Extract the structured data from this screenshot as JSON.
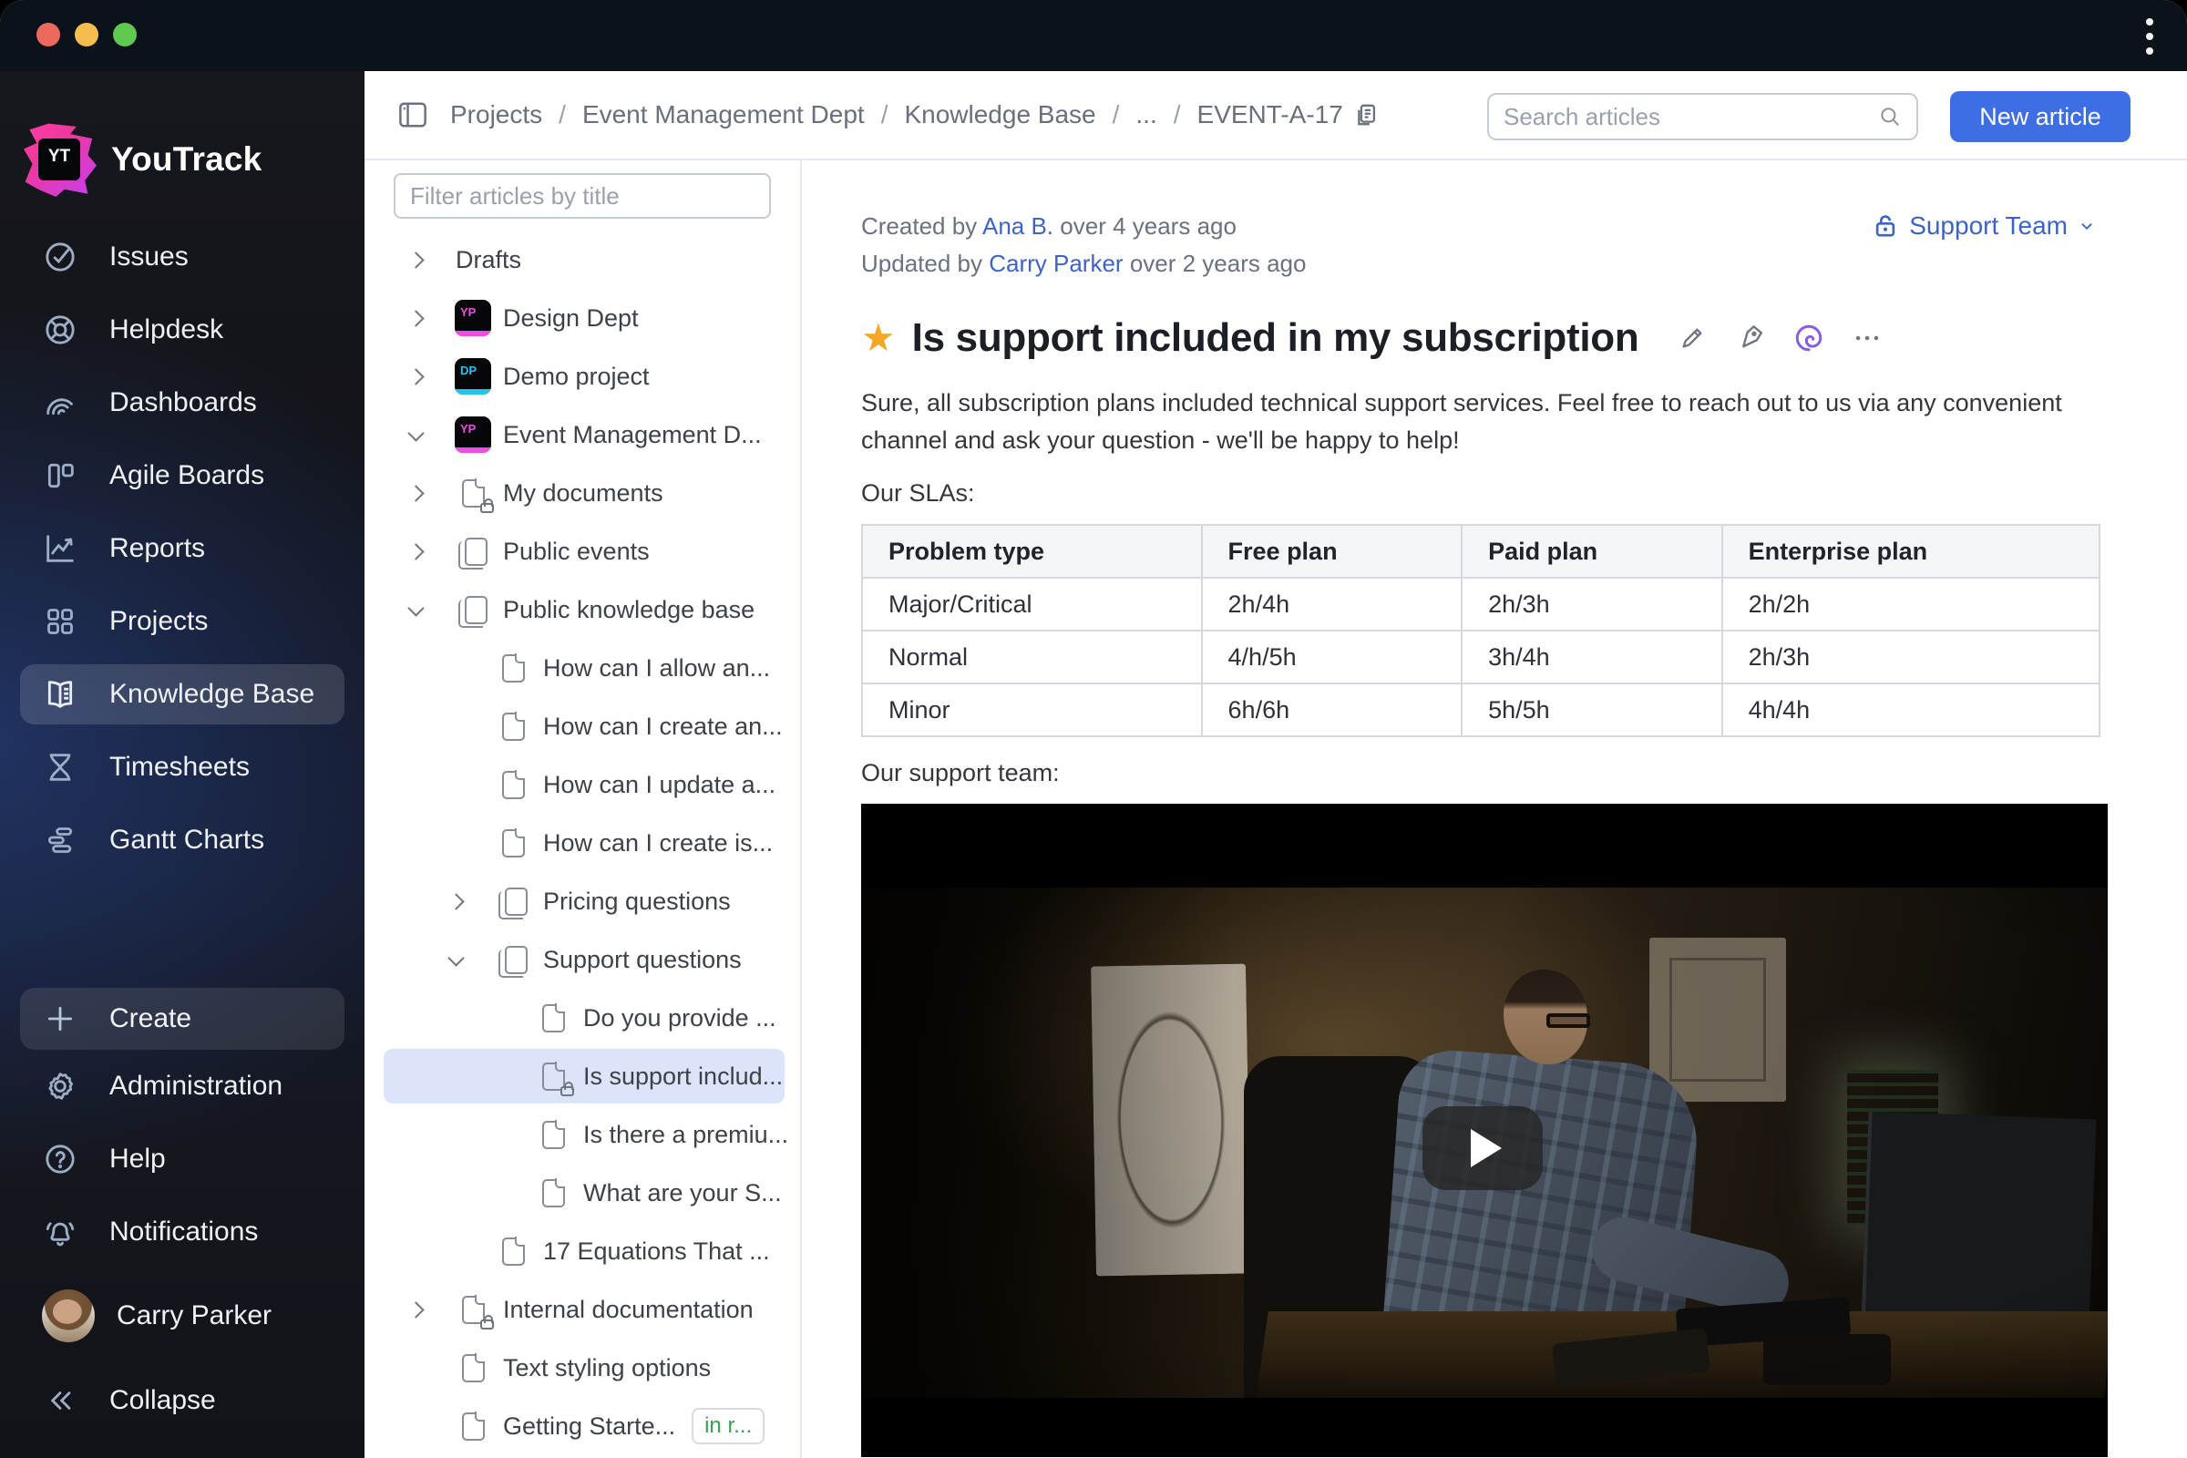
{
  "window": {
    "app_name": "YouTrack"
  },
  "sidebar": {
    "logo_monogram": "YT",
    "logo_text": "YouTrack",
    "items": [
      {
        "label": "Issues"
      },
      {
        "label": "Helpdesk"
      },
      {
        "label": "Dashboards"
      },
      {
        "label": "Agile Boards"
      },
      {
        "label": "Reports"
      },
      {
        "label": "Projects"
      },
      {
        "label": "Knowledge Base",
        "selected": true
      },
      {
        "label": "Timesheets"
      },
      {
        "label": "Gantt Charts"
      }
    ],
    "create_label": "Create",
    "footer_items": [
      {
        "label": "Administration"
      },
      {
        "label": "Help"
      },
      {
        "label": "Notifications"
      }
    ],
    "user_name": "Carry Parker",
    "collapse_label": "Collapse"
  },
  "topbar": {
    "breadcrumb": [
      "Projects",
      "Event Management Dept",
      "Knowledge Base",
      "...",
      "EVENT-A-17"
    ],
    "search_placeholder": "Search articles",
    "new_article_label": "New article"
  },
  "tree": {
    "filter_placeholder": "Filter articles by title",
    "items": [
      {
        "label": "Drafts"
      },
      {
        "label": "Design Dept",
        "project_initials": "YP",
        "project_color": "#ef4fe0"
      },
      {
        "label": "Demo project",
        "project_initials": "DP",
        "project_color": "#22c3f4"
      },
      {
        "label": "Event Management D...",
        "project_initials": "YP",
        "project_color": "#ef4fe0"
      },
      {
        "label": "My documents"
      },
      {
        "label": "Public events"
      },
      {
        "label": "Public knowledge base"
      },
      {
        "label": "How can I allow an..."
      },
      {
        "label": "How can I create an..."
      },
      {
        "label": "How can I update a..."
      },
      {
        "label": "How can I create is..."
      },
      {
        "label": "Pricing questions"
      },
      {
        "label": "Support questions"
      },
      {
        "label": "Do you provide ..."
      },
      {
        "label": "Is support includ...",
        "selected": true
      },
      {
        "label": "Is there a premiu..."
      },
      {
        "label": "What are your S..."
      },
      {
        "label": "17 Equations That ..."
      },
      {
        "label": "Internal documentation"
      },
      {
        "label": "Text styling options"
      },
      {
        "label": "Getting Starte...",
        "badge": "in r..."
      }
    ]
  },
  "article": {
    "created_prefix": "Created by",
    "created_author": "Ana B.",
    "created_suffix": "over 4 years ago",
    "updated_prefix": "Updated by",
    "updated_author": "Carry Parker",
    "updated_suffix": "over 2 years ago",
    "visibility_label": "Support Team",
    "title": "Is support included in my subscription",
    "paragraph": "Sure, all subscription plans included technical support services. Feel free to reach out to us via any convenient channel and ask your question - we'll be happy to help!",
    "slas_label": "Our SLAs:",
    "table": {
      "headers": [
        "Problem type",
        "Free plan",
        "Paid plan",
        "Enterprise plan"
      ],
      "rows": [
        [
          "Major/Critical",
          "2h/4h",
          "2h/3h",
          "2h/2h"
        ],
        [
          "Normal",
          "4/h/5h",
          "3h/4h",
          "2h/3h"
        ],
        [
          "Minor",
          "6h/6h",
          "5h/5h",
          "4h/4h"
        ]
      ]
    },
    "support_team_label": "Our support team:"
  },
  "colors": {
    "accent_blue": "#3d6ee4",
    "link_blue": "#3d63c6",
    "selected_row": "#dce4fb",
    "badge_green": "#399f52",
    "star_gold": "#f5a623",
    "ai_purple": "#875ce8",
    "titlebar": "#0c1219"
  }
}
